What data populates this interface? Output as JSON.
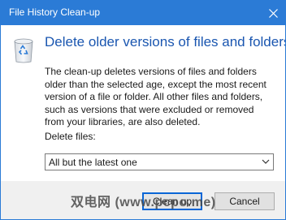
{
  "window": {
    "title": "File History Clean-up"
  },
  "dialog": {
    "heading": "Delete older versions of files and folders",
    "description": "The clean-up deletes versions of files and folders older than the selected age, except the most recent version of a file or folder. All other files and folders, such as versions that were excluded or removed from your libraries, are also deleted.",
    "delete_files_label": "Delete files:",
    "delete_files_select": {
      "selected": "All but the latest one"
    }
  },
  "buttons": {
    "ok": "Clean up",
    "cancel": "Cancel"
  },
  "watermark": "双电网 (www.pcpo.me)",
  "colors": {
    "titlebar": "#2b7bd6",
    "heading": "#1a56b0",
    "footer": "#f0f0f0",
    "focus_border": "#0a66d6"
  },
  "icons": {
    "app": "recycle-bin-icon",
    "close": "close-icon",
    "dropdown": "chevron-down-icon"
  }
}
